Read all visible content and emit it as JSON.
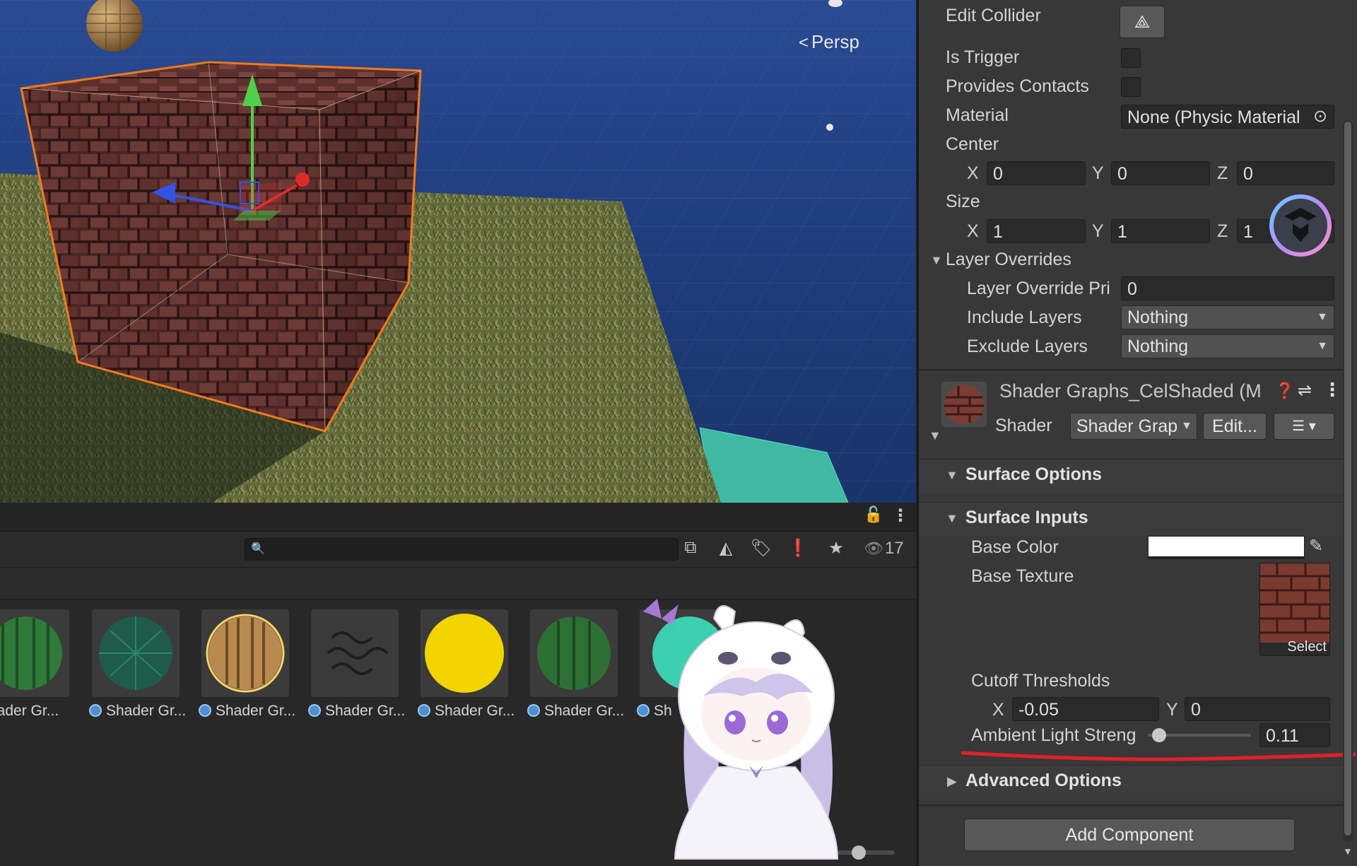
{
  "scene_view": {
    "persp_label": "Persp"
  },
  "inspector": {
    "box_collider": {
      "edit_collider_label": "Edit Collider",
      "is_trigger_label": "Is Trigger",
      "provides_contacts_label": "Provides Contacts",
      "material_label": "Material",
      "material_value": "None (Physic Material",
      "center_label": "Center",
      "center": {
        "x_label": "X",
        "x": "0",
        "y_label": "Y",
        "y": "0",
        "z_label": "Z",
        "z": "0"
      },
      "size_label": "Size",
      "size": {
        "x_label": "X",
        "x": "1",
        "y_label": "Y",
        "y": "1",
        "z_label": "Z",
        "z": "1"
      },
      "layer_overrides_label": "Layer Overrides",
      "layer_override_priority_label": "Layer Override Pri",
      "layer_override_priority_value": "0",
      "include_layers_label": "Include Layers",
      "include_layers_value": "Nothing",
      "exclude_layers_label": "Exclude Layers",
      "exclude_layers_value": "Nothing"
    },
    "material": {
      "name": "Shader Graphs_CelShaded (M",
      "shader_label": "Shader",
      "shader_value": "Shader Grap",
      "edit_button": "Edit...",
      "surface_options_label": "Surface Options",
      "surface_inputs_label": "Surface Inputs",
      "base_color_label": "Base Color",
      "base_color_value": "#ffffff",
      "base_texture_label": "Base Texture",
      "texture_select_label": "Select",
      "cutoff_label": "Cutoff Thresholds",
      "cutoff": {
        "x_label": "X",
        "x": "-0.05",
        "y_label": "Y",
        "y": "0"
      },
      "ambient_label": "Ambient Light Streng",
      "ambient_value": "0.11",
      "ambient_level": 0.11,
      "advanced_options_label": "Advanced Options"
    },
    "add_component_button": "Add Component"
  },
  "project": {
    "search_placeholder": "",
    "visible_count": "17",
    "assets": [
      {
        "label": "Shader Gr...",
        "color": "#2f7a3a"
      },
      {
        "label": "Shader Gr...",
        "color": "#1f5a4a"
      },
      {
        "label": "Shader Gr...",
        "color": "#b98a4f"
      },
      {
        "label": "Shader Gr...",
        "color": "#3a3a3a"
      },
      {
        "label": "Shader Gr...",
        "color": "#f2d500"
      },
      {
        "label": "Shader Gr...",
        "color": "#2e6f35"
      },
      {
        "label": "Sh",
        "color": "#3ccfb0"
      }
    ]
  },
  "colors": {
    "selection_outline": "#f07a1e",
    "annotation_underline": "#e0202a",
    "inspector_bg": "#383838"
  }
}
